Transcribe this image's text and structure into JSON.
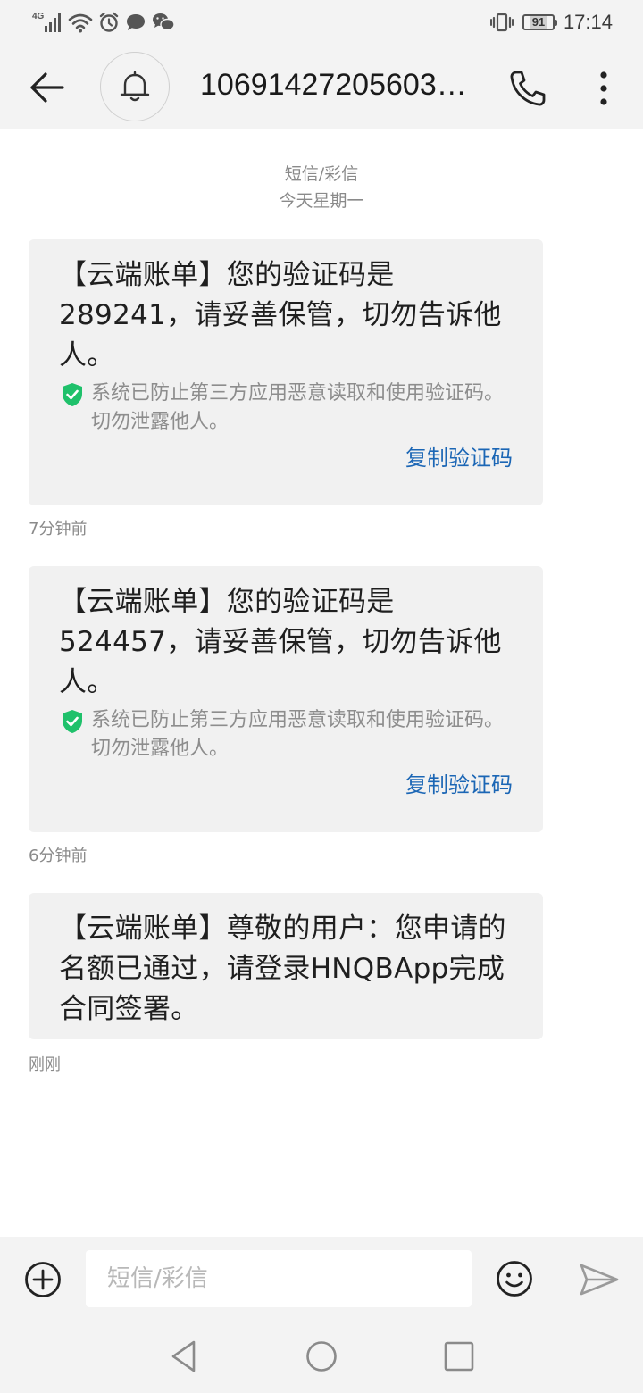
{
  "status_bar": {
    "network": "4G",
    "battery": "91",
    "time": "17:14"
  },
  "header": {
    "contact": "10691427205603…"
  },
  "conversation": {
    "type_label": "短信/彩信",
    "date_label": "今天星期一",
    "messages": [
      {
        "text": "【云端账单】您的验证码是289241，请妥善保管，切勿告诉他人。",
        "notice": "系统已防止第三方应用恶意读取和使用验证码。切勿泄露他人。",
        "copy_label": "复制验证码",
        "time": "7分钟前"
      },
      {
        "text": "【云端账单】您的验证码是524457，请妥善保管，切勿告诉他人。",
        "notice": "系统已防止第三方应用恶意读取和使用验证码。切勿泄露他人。",
        "copy_label": "复制验证码",
        "time": "6分钟前"
      },
      {
        "text": "【云端账单】尊敬的用户：您申请的名额已通过，请登录HNQBApp完成合同签署。",
        "time": "刚刚"
      }
    ]
  },
  "composer": {
    "placeholder": "短信/彩信",
    "value": ""
  },
  "colors": {
    "bar_background": "#f3f3f3",
    "bubble_background": "#f1f1f1",
    "link_blue": "#1b66b5",
    "shield_green": "#1fc16b"
  }
}
